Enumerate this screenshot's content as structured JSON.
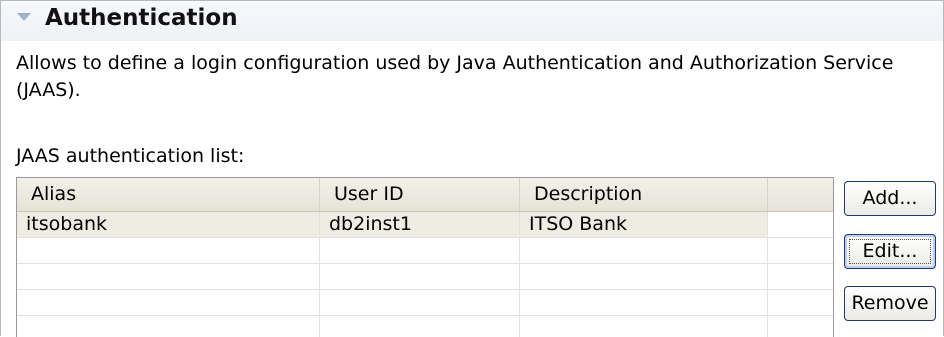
{
  "section": {
    "title": "Authentication",
    "description": "Allows to define a login configuration used by Java Authentication and Authorization Service (JAAS).",
    "twistie_icon": "twistie-expanded-icon"
  },
  "jaas_list": {
    "label": "JAAS authentication list:",
    "columns": [
      "Alias",
      "User ID",
      "Description",
      ""
    ],
    "rows": [
      {
        "alias": "itsobank",
        "user_id": "db2inst1",
        "description": "ITSO Bank",
        "extra": ""
      },
      {
        "alias": "",
        "user_id": "",
        "description": "",
        "extra": ""
      },
      {
        "alias": "",
        "user_id": "",
        "description": "",
        "extra": ""
      },
      {
        "alias": "",
        "user_id": "",
        "description": "",
        "extra": ""
      },
      {
        "alias": "",
        "user_id": "",
        "description": "",
        "extra": ""
      }
    ],
    "selected_row": 0
  },
  "buttons": {
    "add_label": "Add...",
    "edit_label": "Edit...",
    "remove_label": "Remove"
  },
  "colors": {
    "header_bg": "#eef1f6",
    "selected_row_bg": "#efece3",
    "button_border": "#1f3a70",
    "twistie": "#9fb3cc"
  }
}
